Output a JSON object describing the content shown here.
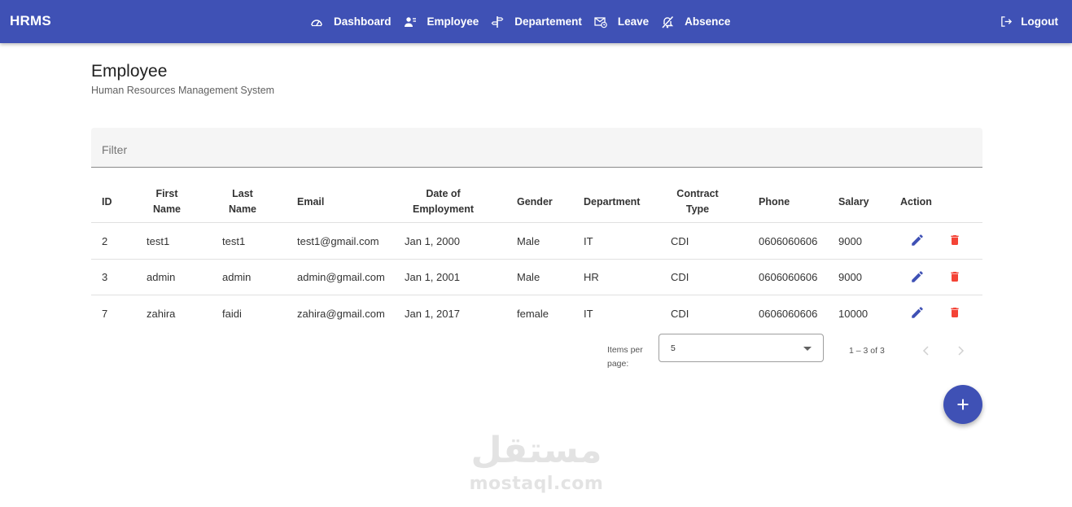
{
  "app": {
    "brand": "HRMS"
  },
  "nav": {
    "items": [
      {
        "label": "Dashboard",
        "icon": "speedometer-icon"
      },
      {
        "label": "Employee",
        "icon": "people-icon"
      },
      {
        "label": "Departement",
        "icon": "signpost-icon"
      },
      {
        "label": "Leave",
        "icon": "mail-clock-icon"
      },
      {
        "label": "Absence",
        "icon": "bell-off-icon"
      }
    ],
    "logout_label": "Logout"
  },
  "page": {
    "title": "Employee",
    "subtitle": "Human Resources Management System"
  },
  "filter": {
    "placeholder": "Filter"
  },
  "table": {
    "columns": [
      "ID",
      "First Name",
      "Last Name",
      "Email",
      "Date of Employment",
      "Gender",
      "Department",
      "Contract Type",
      "Phone",
      "Salary",
      "Action"
    ],
    "rows": [
      [
        "2",
        "test1",
        "test1",
        "test1@gmail.com",
        "Jan 1, 2000",
        "Male",
        "IT",
        "CDI",
        "0606060606",
        "9000"
      ],
      [
        "3",
        "admin",
        "admin",
        "admin@gmail.com",
        "Jan 1, 2001",
        "Male",
        "HR",
        "CDI",
        "0606060606",
        "9000"
      ],
      [
        "7",
        "zahira",
        "faidi",
        "zahira@gmail.com",
        "Jan 1, 2017",
        "female",
        "IT",
        "CDI",
        "0606060606",
        "10000"
      ]
    ]
  },
  "paginator": {
    "items_per_page_label": "Items per page:",
    "page_size": "5",
    "range_label": "1 – 3 of 3"
  },
  "colors": {
    "primary": "#3f51b5",
    "delete": "#f44336"
  },
  "watermark": {
    "arabic": "مستقل",
    "latin": "mostaql.com"
  }
}
